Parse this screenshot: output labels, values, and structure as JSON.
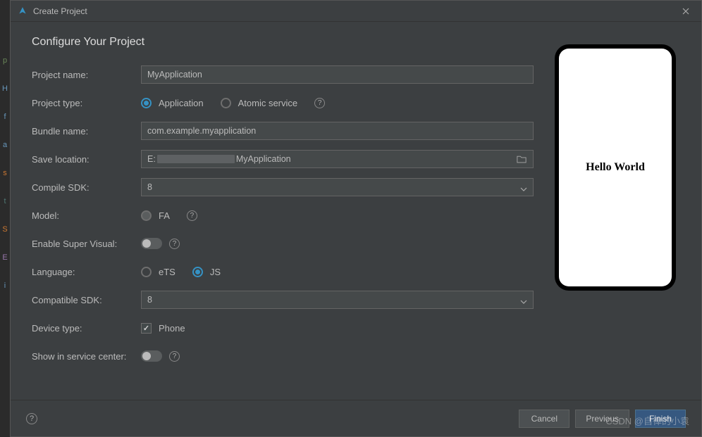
{
  "window": {
    "title": "Create Project"
  },
  "heading": "Configure Your Project",
  "form": {
    "projectName": {
      "label": "Project name:",
      "value": "MyApplication"
    },
    "projectType": {
      "label": "Project type:",
      "options": {
        "application": "Application",
        "atomic": "Atomic service"
      },
      "selected": "application"
    },
    "bundleName": {
      "label": "Bundle name:",
      "value": "com.example.myapplication"
    },
    "saveLocation": {
      "label": "Save location:",
      "prefix": "E:",
      "suffix": "MyApplication"
    },
    "compileSdk": {
      "label": "Compile SDK:",
      "value": "8"
    },
    "model": {
      "label": "Model:",
      "value": "FA"
    },
    "enableSuperVisual": {
      "label": "Enable Super Visual:",
      "value": false
    },
    "language": {
      "label": "Language:",
      "options": {
        "ets": "eTS",
        "js": "JS"
      },
      "selected": "js"
    },
    "compatibleSdk": {
      "label": "Compatible SDK:",
      "value": "8"
    },
    "deviceType": {
      "label": "Device type:",
      "value": "Phone",
      "checked": true
    },
    "showInServiceCenter": {
      "label": "Show in service center:",
      "value": false
    }
  },
  "preview": {
    "text": "Hello World"
  },
  "footer": {
    "cancel": "Cancel",
    "previous": "Previous",
    "finish": "Finish"
  },
  "watermark": "CSDN @自律的小袁",
  "gutter": [
    "p",
    "H",
    "f",
    "a",
    "s",
    "t",
    "S",
    "E",
    "i"
  ]
}
